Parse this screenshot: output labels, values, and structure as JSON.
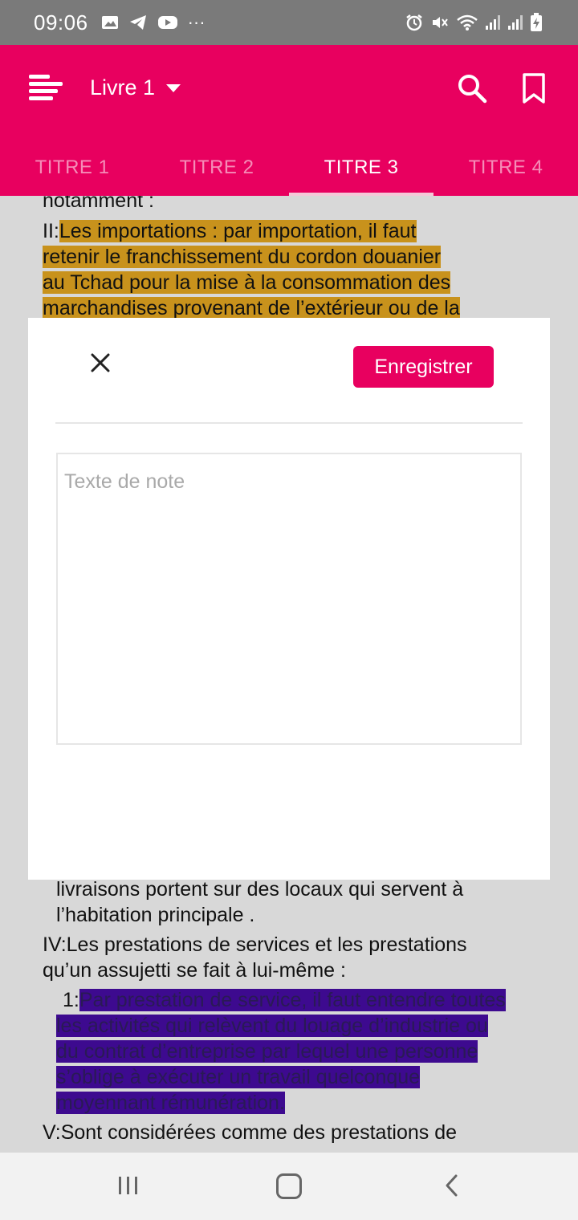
{
  "status_bar": {
    "time": "09:06",
    "left_icons": [
      "gallery-icon",
      "telegram-icon",
      "youtube-icon",
      "more-dots-icon"
    ],
    "right_icons": [
      "alarm-icon",
      "mute-icon",
      "wifi-icon",
      "signal-icon",
      "signal-icon",
      "battery-charging-icon"
    ]
  },
  "app_bar": {
    "book_selector": "Livre 1",
    "tabs": [
      "TITRE 1",
      "TITRE 2",
      "TITRE 3",
      "TITRE 4"
    ],
    "active_tab": "TITRE 3",
    "accent_color": "#e8005f"
  },
  "document": {
    "top_lines": {
      "l0": "notamment :",
      "l1_prefix": " II:",
      "l1_hl": "Les importations : par importation, il faut",
      "l2": "retenir le franchissement du cordon douanier",
      "l3": "au Tchad pour la mise à la consommation des",
      "l4": "marchandises provenant de l’extérieur ou de la"
    },
    "bottom_lines": {
      "b1": "livraisons portent sur des locaux qui servent à",
      "b2": "l’habitation principale .",
      "b3": " IV:Les prestations de services et les prestations",
      "b4": "qu’un assujetti se fait à lui-même :",
      "b5_prefix": "1:",
      "b5_hl": "Par prestation de service, il faut entendre toutes",
      "b6": "les activités qui relèvent du louage d’industrie ou",
      "b7": "du contrat d’entreprise par lequel une personne",
      "b8": "s’oblige à exécuter un travail quelconque",
      "b9": "moyennant rémunération.",
      "b10": " V:Sont considérées comme des prestations de"
    },
    "highlight_colors": {
      "gold": "#c8921c",
      "purple": "#3d0a8f"
    }
  },
  "note_dialog": {
    "save_label": "Enregistrer",
    "placeholder": "Texte de note",
    "value": ""
  }
}
